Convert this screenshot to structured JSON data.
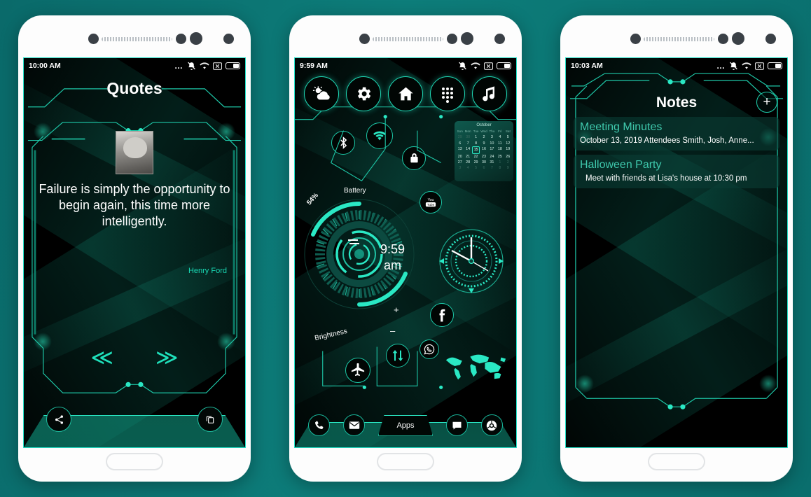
{
  "background": {
    "color_start": "#0a6a6a",
    "color_end": "#0d7d7a"
  },
  "theme": {
    "accent": "#1fd9b6",
    "accent_bright": "#2ae8c4",
    "screen_bg": "#000000",
    "text": "#ffffff"
  },
  "phones": [
    {
      "name": "quotes-phone",
      "status_bar": {
        "time": "10:00 AM",
        "icons": [
          "more-icon",
          "bell-muted-icon",
          "wifi-icon",
          "x-box-icon",
          "battery-icon"
        ]
      },
      "screen": {
        "title": "Quotes",
        "portrait_alt": "henry-ford-portrait",
        "quote": "Failure is simply the opportunity to begin again, this time more intelligently.",
        "author": "Henry Ford",
        "prev_label": "≪",
        "next_label": "≫",
        "share_icon": "share-icon",
        "copy_icon": "copy-icon"
      }
    },
    {
      "name": "launcher-phone",
      "status_bar": {
        "time": "9:59 AM",
        "icons": [
          "bell-muted-icon",
          "wifi-icon",
          "x-box-icon",
          "battery-icon"
        ]
      },
      "screen": {
        "top_icons": [
          {
            "name": "weather-icon",
            "label": "Weather"
          },
          {
            "name": "settings-gear-icon",
            "label": "Settings"
          },
          {
            "name": "home-icon",
            "label": "Home"
          },
          {
            "name": "dialpad-icon",
            "label": "Dialpad"
          },
          {
            "name": "music-note-icon",
            "label": "Music"
          }
        ],
        "toggles": [
          {
            "name": "bluetooth-icon",
            "label": "Bluetooth"
          },
          {
            "name": "wifi-toggle-icon",
            "label": "WiFi"
          },
          {
            "name": "lock-icon",
            "label": "Lock"
          }
        ],
        "calendar": {
          "month": "October",
          "day_headers": [
            "Sun",
            "Mon",
            "Tue",
            "Wed",
            "Thu",
            "Fri",
            "Sat"
          ],
          "leading_days": [
            29,
            30
          ],
          "days_in_month": 31,
          "today": 15,
          "trailing_days": [
            1,
            2,
            3,
            4,
            5,
            6,
            7,
            8,
            9
          ]
        },
        "battery_label": "Battery",
        "battery_percent": "54%",
        "brightness_label": "Brightness",
        "brightness_plus": "+",
        "brightness_minus": "–",
        "digital_time": "9:59",
        "digital_meridiem": "am",
        "analog_clock": {
          "hour": 10,
          "minute": 0
        },
        "apps": [
          {
            "name": "youtube-icon",
            "label": "YouTube"
          },
          {
            "name": "facebook-icon",
            "label": "Facebook"
          },
          {
            "name": "whatsapp-icon",
            "label": "WhatsApp"
          },
          {
            "name": "airplane-mode-icon",
            "label": "Airplane mode"
          },
          {
            "name": "data-transfer-icon",
            "label": "Data transfer"
          }
        ],
        "world_map_label": "world-map",
        "dock": [
          {
            "name": "phone-icon",
            "label": "Phone"
          },
          {
            "name": "email-icon",
            "label": "Email"
          },
          {
            "name": "apps-button",
            "label": "Apps"
          },
          {
            "name": "messages-icon",
            "label": "Messages"
          },
          {
            "name": "chrome-icon",
            "label": "Chrome"
          }
        ]
      }
    },
    {
      "name": "notes-phone",
      "status_bar": {
        "time": "10:03 AM",
        "icons": [
          "more-icon",
          "bell-muted-icon",
          "wifi-icon",
          "x-box-icon",
          "battery-icon"
        ]
      },
      "screen": {
        "title": "Notes",
        "add_label": "+",
        "notes": [
          {
            "title": "Meeting Minutes",
            "body": "October 13, 2019 Attendees Smith, Josh, Anne..."
          },
          {
            "title": "Halloween Party",
            "body": "Meet with friends at Lisa's house at 10:30 pm"
          }
        ]
      }
    }
  ]
}
